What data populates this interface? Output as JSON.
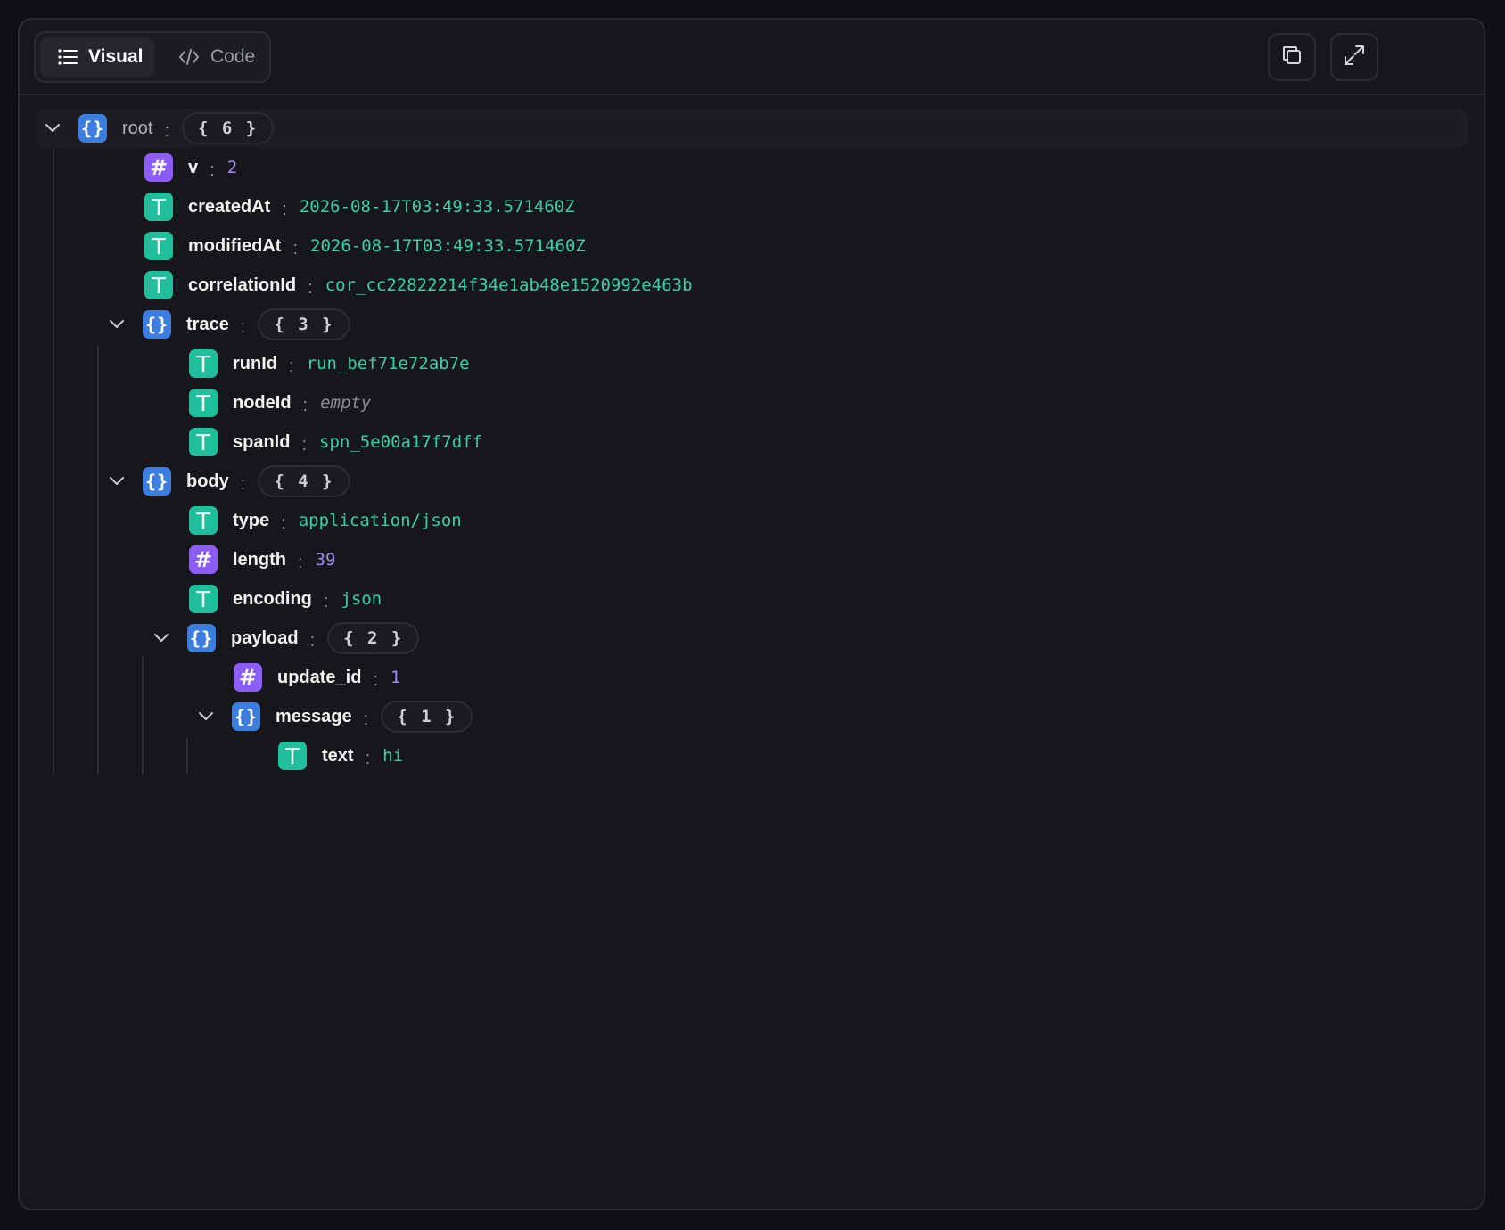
{
  "tabs": [
    {
      "label": "Visual",
      "icon": "list-icon",
      "active": true
    },
    {
      "label": "Code",
      "icon": "code-icon",
      "active": false
    }
  ],
  "actions": [
    {
      "name": "copy-button",
      "icon": "copy-icon"
    },
    {
      "name": "expand-button",
      "icon": "expand-icon"
    }
  ],
  "colors": {
    "object_badge": "#3b7ee0",
    "number_badge": "#8b5cf6",
    "string_badge": "#1fbf9c",
    "string_value": "#3ccfa6",
    "number_value": "#a58bf5"
  },
  "tree": {
    "root": {
      "key": "root",
      "count": "{ 6 }"
    },
    "v": {
      "key": "v",
      "value": "2"
    },
    "createdAt": {
      "key": "createdAt",
      "value": "2026-08-17T03:49:33.571460Z"
    },
    "modifiedAt": {
      "key": "modifiedAt",
      "value": "2026-08-17T03:49:33.571460Z"
    },
    "correlationId": {
      "key": "correlationId",
      "value": "cor_cc22822214f34e1ab48e1520992e463b"
    },
    "trace": {
      "key": "trace",
      "count": "{ 3 }"
    },
    "runId": {
      "key": "runId",
      "value": "run_bef71e72ab7e"
    },
    "nodeId": {
      "key": "nodeId",
      "value": "empty"
    },
    "spanId": {
      "key": "spanId",
      "value": "spn_5e00a17f7dff"
    },
    "body": {
      "key": "body",
      "count": "{ 4 }"
    },
    "type": {
      "key": "type",
      "value": "application/json"
    },
    "length": {
      "key": "length",
      "value": "39"
    },
    "encoding": {
      "key": "encoding",
      "value": "json"
    },
    "payload": {
      "key": "payload",
      "count": "{ 2 }"
    },
    "update_id": {
      "key": "update_id",
      "value": "1"
    },
    "message": {
      "key": "message",
      "count": "{ 1 }"
    },
    "text": {
      "key": "text",
      "value": "hi"
    }
  },
  "separator": ":",
  "badges": {
    "object": "{}",
    "number": "#",
    "string": "T"
  }
}
